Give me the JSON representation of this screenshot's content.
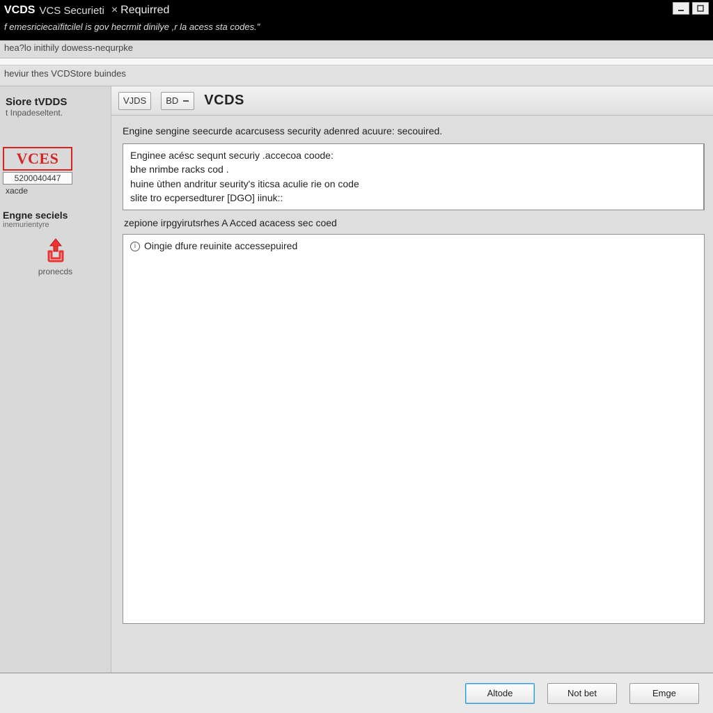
{
  "titlebar": {
    "brand": "VCDS",
    "secondary": "VCS Securieti",
    "separator": "×",
    "rest": "Requirred",
    "subtitle": "f emesriciecaïfitcilel is gov hecrmit dinilye ,r la acess sta codes.\""
  },
  "strip1": "hea?lo inithily dowess-nequrpke",
  "strip2": "heviur thes VCDStore buindes",
  "sidebar": {
    "store": {
      "title": "Siore tVDDS",
      "sub": "t Inpadeseltent."
    },
    "logo": {
      "text": "VCES",
      "code": "5200040447",
      "caption": "xacde"
    },
    "engine": {
      "title": "Engne seciels",
      "sub": "inemurientyre"
    },
    "upload_caption": "pronecds"
  },
  "toolbar": {
    "btn1": "VJDS",
    "btn2": "BD",
    "brand": "VCDS"
  },
  "main": {
    "header_line": "Engine  sengine seecurde acarcusess security adenred acuure: secouired.",
    "panel_a_lines": [
      "Enginee acésc sequnt securiy .accecoa coode:",
      "bhe nrimbe racks cod .",
      "huine ùthen andritur seurity's iticsa aculie rie on code",
      "slite tro ecpersedturer  [DGO] iinuk::"
    ],
    "mid_label": "zepione irpgyirutsrhes A Acced acacess sec coed",
    "panel_b_line": "Oingie dfure reuinite accessepuired"
  },
  "buttons": {
    "primary": "Altode",
    "secondary": "Not bet",
    "tertiary": "Emge"
  }
}
